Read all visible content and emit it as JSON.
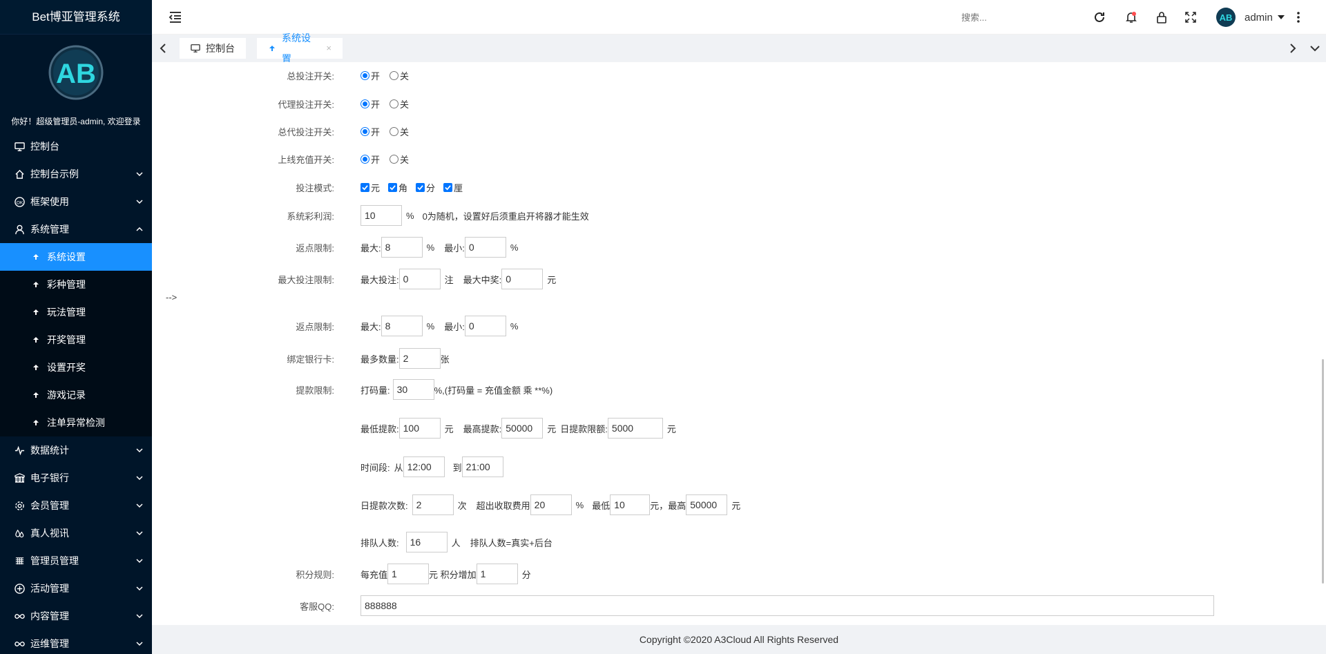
{
  "app": {
    "title": "Bet博亚管理系统",
    "greeting": "你好！超级管理员-admin, 欢迎登录"
  },
  "sidebar": {
    "items": [
      {
        "label": "控制台",
        "icon": "monitor-icon",
        "expandable": false
      },
      {
        "label": "控制台示例",
        "icon": "home-icon",
        "expandable": true
      },
      {
        "label": "框架使用",
        "icon": "ok-icon",
        "expandable": true
      },
      {
        "label": "系统管理",
        "icon": "user-icon",
        "expandable": true,
        "expanded": true
      }
    ],
    "submenu": [
      {
        "label": "系统设置",
        "active": true
      },
      {
        "label": "彩种管理"
      },
      {
        "label": "玩法管理"
      },
      {
        "label": "开奖管理"
      },
      {
        "label": "设置开奖"
      },
      {
        "label": "游戏记录"
      },
      {
        "label": "注单异常检测"
      }
    ],
    "items_after": [
      {
        "label": "数据统计",
        "icon": "pulse-icon"
      },
      {
        "label": "电子银行",
        "icon": "bank-icon"
      },
      {
        "label": "会员管理",
        "icon": "gear-icon"
      },
      {
        "label": "真人视讯",
        "icon": "drops-icon"
      },
      {
        "label": "管理员管理",
        "icon": "grid-icon"
      },
      {
        "label": "活动管理",
        "icon": "plus-circle-icon"
      },
      {
        "label": "内容管理",
        "icon": "infinity-icon"
      },
      {
        "label": "运维管理",
        "icon": "infinity-icon"
      }
    ]
  },
  "header": {
    "search_placeholder": "搜索...",
    "username": "admin"
  },
  "tabs": [
    {
      "label": "控制台",
      "active": false
    },
    {
      "label": "系统设置",
      "active": true,
      "close": "×"
    }
  ],
  "form": {
    "radio_on": "开",
    "radio_off": "关",
    "total_bet_label": "总投注开关:",
    "agent_bet_label": "代理投注开关:",
    "general_agent_bet_label": "总代投注开关:",
    "online_recharge_label": "上线充值开关:",
    "bet_mode_label": "投注模式:",
    "bet_modes": [
      "元",
      "角",
      "分",
      "厘"
    ],
    "profit_label": "系统彩利润:",
    "profit_value": "10",
    "percent": "%",
    "profit_note": "0为随机，设置好后须重启开将器才能生效",
    "rebate_label": "返点限制:",
    "max_label": "最大:",
    "min_label": "最小:",
    "rebate_max": "8",
    "rebate_min": "0",
    "max_bet_label": "最大投注限制:",
    "max_bet_text": "最大投注:",
    "max_bet_value": "0",
    "bet_unit": "注",
    "max_win_text": "最大中奖:",
    "max_win_value": "0",
    "yuan": "元",
    "comment_end": "-->",
    "rebate2_max": "8",
    "rebate2_min": "0",
    "bank_label": "绑定银行卡:",
    "bank_max_text": "最多数量:",
    "bank_max_value": "2",
    "bank_unit": "张",
    "withdraw_label": "提款限制:",
    "dama_text": "打码量:",
    "dama_value": "30",
    "dama_note": "%,(打码量 = 充值金额 乘 **%)",
    "min_withdraw_text": "最低提款:",
    "min_withdraw_value": "100",
    "max_withdraw_text": "最高提款:",
    "max_withdraw_value": "50000",
    "daily_limit_text": "日提款限额:",
    "daily_limit_value": "5000",
    "period_text": "时间段:",
    "from_text": "从",
    "from_value": "12:00",
    "to_text": "到",
    "to_value": "21:00",
    "daily_times_text": "日提款次数:",
    "daily_times_value": "2",
    "times_unit": "次",
    "exceed_fee_text": "超出收取费用",
    "exceed_fee_value": "20",
    "lowest_text": "最低",
    "lowest_value": "10",
    "yuan_comma": "元，最高",
    "highest_value": "50000",
    "queue_text": "排队人数:",
    "queue_value": "16",
    "person_unit": "人",
    "queue_note": "排队人数=真实+后台",
    "points_label": "积分规则:",
    "per_recharge_text": "每充值",
    "per_recharge_value": "1",
    "points_add_text": "元 积分增加",
    "points_add_value": "1",
    "points_unit": "分",
    "qq_label": "客服QQ:",
    "qq_value": "888888"
  },
  "footer": {
    "copyright": "Copyright ©2020 A3Cloud All Rights Reserved"
  },
  "colors": {
    "sidebar_bg": "#001529",
    "submenu_bg": "#000c17",
    "accent": "#1890ff"
  }
}
